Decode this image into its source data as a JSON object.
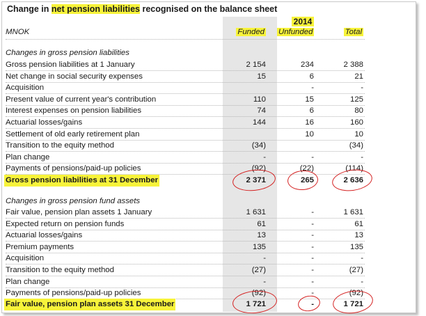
{
  "title": {
    "pre": "Change in ",
    "highlight": "net pension liabilities",
    "post": " recognised on the balance sheet"
  },
  "year": "2014",
  "header": {
    "unit": "MNOK",
    "funded": "Funded",
    "unfunded": "Unfunded",
    "total": "Total"
  },
  "section1_title": "Changes in gross pension liabilities",
  "section1_rows": [
    {
      "label": "Gross pension liabilities at 1 January",
      "funded": "2 154",
      "unfunded": "234",
      "total": "2 388"
    },
    {
      "label": "Net change in social security expenses",
      "funded": "15",
      "unfunded": "6",
      "total": "21"
    },
    {
      "label": "Acquisition",
      "funded": "",
      "unfunded": "-",
      "total": "-"
    },
    {
      "label": "Present value of current year's contribution",
      "funded": "110",
      "unfunded": "15",
      "total": "125"
    },
    {
      "label": "Interest expenses on pension liabilities",
      "funded": "74",
      "unfunded": "6",
      "total": "80"
    },
    {
      "label": "Actuarial losses/gains",
      "funded": "144",
      "unfunded": "16",
      "total": "160"
    },
    {
      "label": "Settlement of old early retirement plan",
      "funded": "",
      "unfunded": "10",
      "total": "10"
    },
    {
      "label": "Transition to the equity method",
      "funded": "(34)",
      "unfunded": "",
      "total": "(34)"
    },
    {
      "label": "Plan change",
      "funded": "-",
      "unfunded": "-",
      "total": "-"
    },
    {
      "label": "Payments of pensions/paid-up policies",
      "funded": "(92)",
      "unfunded": "(22)",
      "total": "(114)"
    }
  ],
  "section1_total": {
    "label": "Gross pension liabilities at 31 December",
    "funded": "2 371",
    "unfunded": "265",
    "total": "2 636"
  },
  "section2_title": "Changes in gross pension fund assets",
  "section2_rows": [
    {
      "label": "Fair value, pension plan assets 1 January",
      "funded": "1 631",
      "unfunded": "-",
      "total": "1 631"
    },
    {
      "label": "Expected return on pension funds",
      "funded": "61",
      "unfunded": "-",
      "total": "61"
    },
    {
      "label": "Actuarial losses/gains",
      "funded": "13",
      "unfunded": "-",
      "total": "13"
    },
    {
      "label": "Premium payments",
      "funded": "135",
      "unfunded": "-",
      "total": "135"
    },
    {
      "label": "Acquisition",
      "funded": "-",
      "unfunded": "-",
      "total": "-"
    },
    {
      "label": "Transition to the equity method",
      "funded": "(27)",
      "unfunded": "-",
      "total": "(27)"
    },
    {
      "label": "Plan change",
      "funded": "-",
      "unfunded": "-",
      "total": "-"
    },
    {
      "label": "Payments of pensions/paid-up policies",
      "funded": "(92)",
      "unfunded": "-",
      "total": "(92)"
    }
  ],
  "section2_total": {
    "label": "Fair value, pension plan assets 31 December",
    "funded": "1 721",
    "unfunded": "-",
    "total": "1 721"
  },
  "colors": {
    "highlight": "#f7f33a",
    "shade": "#e6e6e6",
    "annotation": "#d42020"
  }
}
